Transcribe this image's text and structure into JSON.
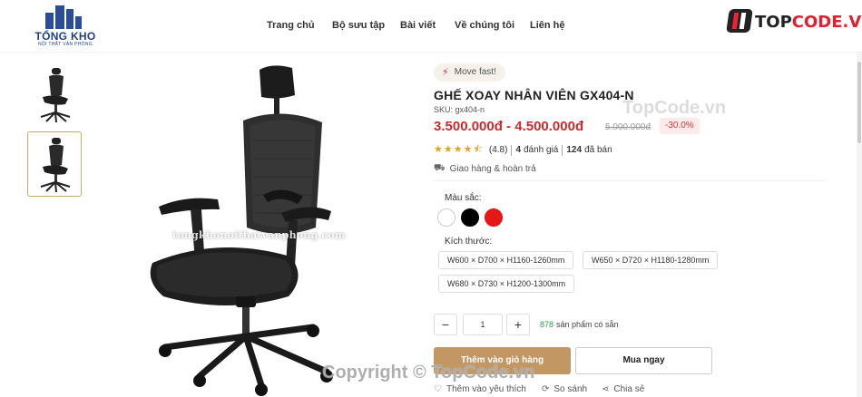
{
  "header": {
    "logo": {
      "title": "TỔNG KHO",
      "subtitle": "NỘI THẤT VĂN PHÒNG"
    },
    "nav": [
      {
        "label": "Trang chủ"
      },
      {
        "label": "Bộ sưu tập"
      },
      {
        "label": "Bài viết"
      },
      {
        "label": "Về chúng tôi"
      },
      {
        "label": "Liên hệ"
      }
    ],
    "brand": {
      "left": "TOP",
      "right": "CODE.VN"
    }
  },
  "gallery": {
    "selected_index": 1,
    "image_watermark": "tongkhonoithatvanphong.com"
  },
  "product": {
    "badge": "Move fast!",
    "title": "GHẾ XOAY NHÂN VIÊN GX404-N",
    "sku": "SKU: gx404-n",
    "price_range": "3.500.000đ - 4.500.000đ",
    "old_price": "5.000.000đ",
    "discount": "-30.0%",
    "rating_value": "(4.8)",
    "stars": 4.5,
    "reviews_count": "4",
    "reviews_label": "đánh giá",
    "sold_count": "124",
    "sold_label": "đã bán",
    "shipping": "Giao hàng & hoàn trả",
    "color_label": "Màu sắc:",
    "colors": [
      "#ffffff",
      "#000000",
      "#e61717"
    ],
    "size_label": "Kích thước:",
    "sizes": [
      "W600 × D700 × H1160-1260mm",
      "W650 × D720 × H1180-1280mm",
      "W680 × D730 × H1200-1300mm"
    ],
    "quantity": "1",
    "stock_count": "878",
    "stock_label": "sản phẩm có sẵn",
    "add_to_cart": "Thêm vào giỏ hàng",
    "buy_now": "Mua ngay",
    "actions": {
      "wishlist": "Thêm vào yêu thích",
      "compare": "So sánh",
      "share": "Chia sẻ"
    }
  },
  "watermarks": {
    "top": "TopCode.vn",
    "bottom": "Copyright © TopCode.vn"
  }
}
